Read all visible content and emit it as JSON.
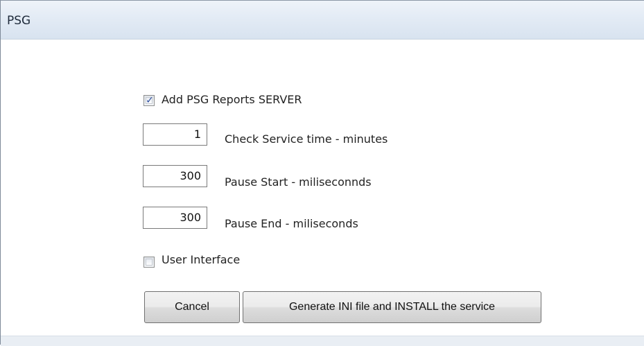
{
  "window": {
    "title": "PSG"
  },
  "form": {
    "add_server": {
      "label": "Add PSG Reports SERVER",
      "checked": true
    },
    "check_service": {
      "value": "1",
      "label": "Check Service time - minutes"
    },
    "pause_start": {
      "value": "300",
      "label": "Pause Start - miliseconnds"
    },
    "pause_end": {
      "value": "300",
      "label": "Pause End - miliseconds"
    },
    "user_interface": {
      "label": "User Interface",
      "checked": false
    }
  },
  "buttons": {
    "cancel": "Cancel",
    "generate": "Generate INI file and INSTALL the service"
  }
}
